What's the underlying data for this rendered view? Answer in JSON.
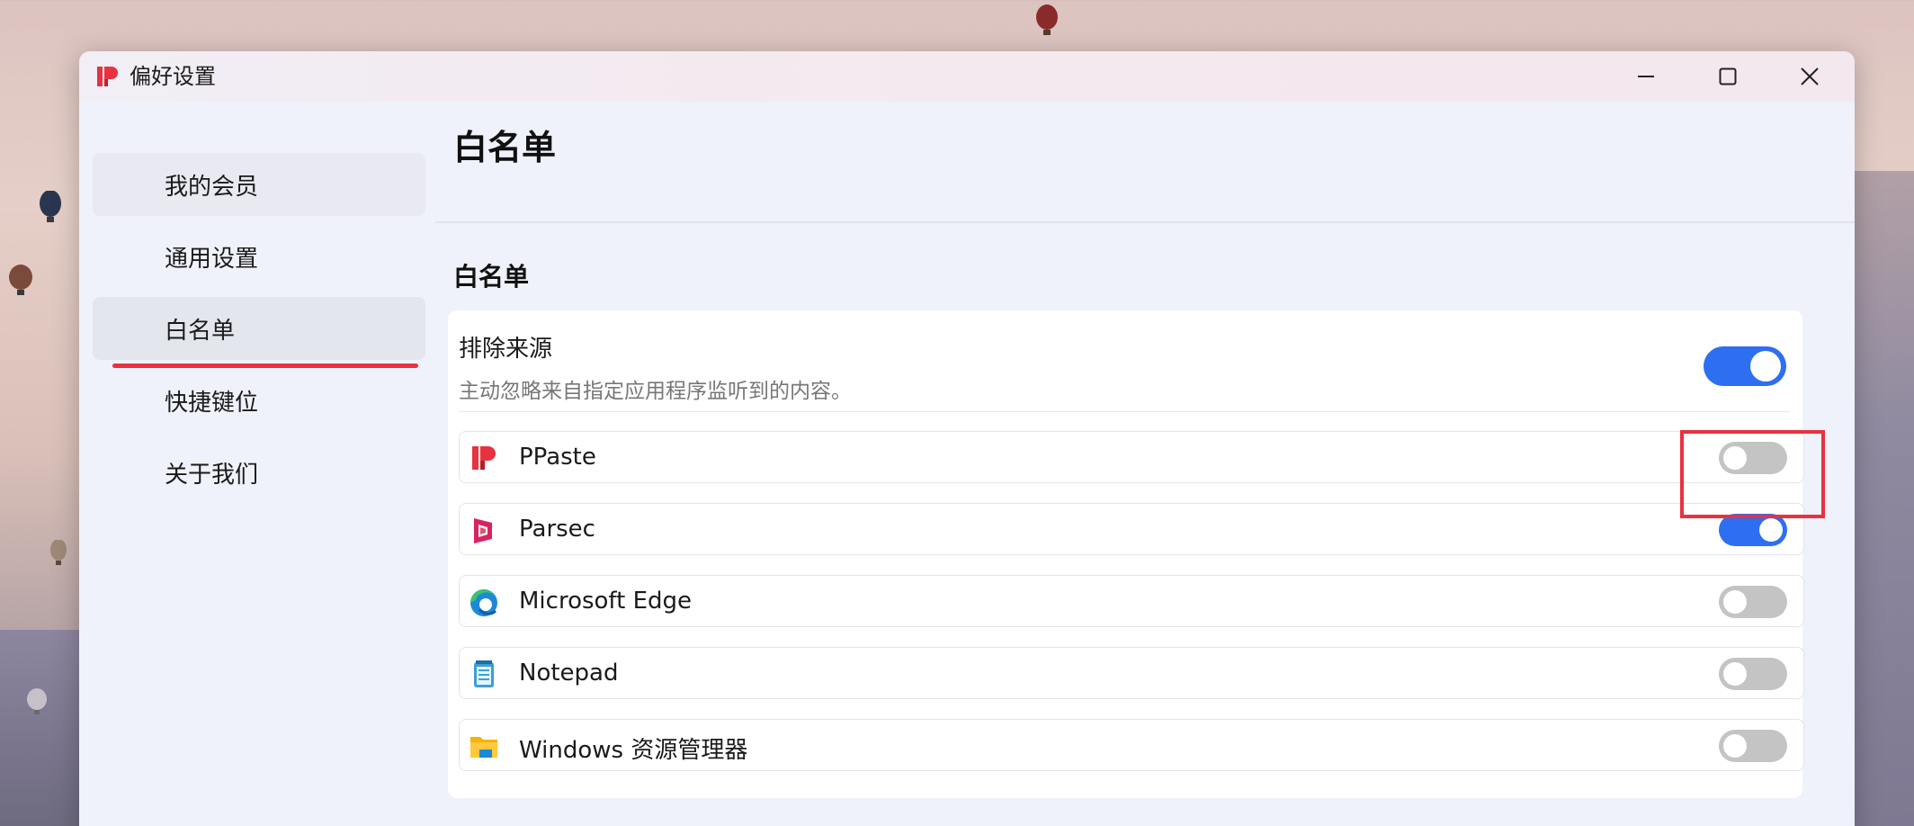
{
  "window": {
    "title": "偏好设置"
  },
  "sidebar": {
    "items": [
      {
        "label": "我的会员"
      },
      {
        "label": "通用设置"
      },
      {
        "label": "白名单"
      },
      {
        "label": "快捷键位"
      },
      {
        "label": "关于我们"
      }
    ],
    "active": "白名单"
  },
  "main": {
    "page_title": "白名单",
    "section_title": "白名单",
    "exclude": {
      "label": "排除来源",
      "description": "主动忽略来自指定应用程序监听到的内容。",
      "enabled": true
    },
    "apps": [
      {
        "name": "PPaste",
        "icon": "ppaste-icon",
        "enabled": false
      },
      {
        "name": "Parsec",
        "icon": "parsec-icon",
        "enabled": true
      },
      {
        "name": "Microsoft Edge",
        "icon": "edge-icon",
        "enabled": false
      },
      {
        "name": "Notepad",
        "icon": "notepad-icon",
        "enabled": false
      },
      {
        "name": "Windows 资源管理器",
        "icon": "folder-icon",
        "enabled": false
      }
    ]
  },
  "colors": {
    "accent": "#2d6ff0",
    "toggle_off": "#c4c4c4",
    "annotation": "#e8323f"
  }
}
